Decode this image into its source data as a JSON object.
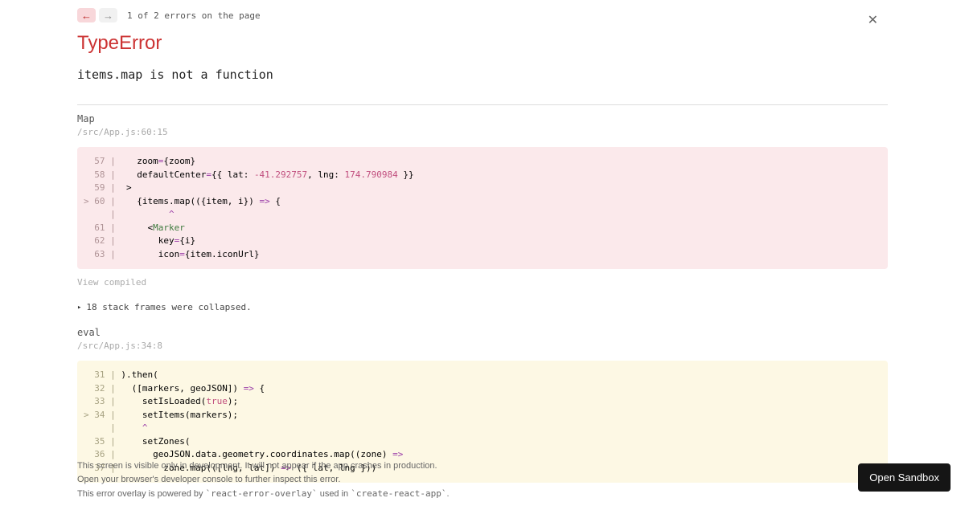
{
  "nav": {
    "counter_text": "1 of 2 errors on the page"
  },
  "error": {
    "type": "TypeError",
    "message": "items.map is not a function"
  },
  "frame1": {
    "name": "Map",
    "location": "/src/App.js:60:15",
    "view_compiled": "View compiled"
  },
  "collapsed_text": "18 stack frames were collapsed.",
  "frame2": {
    "name": "eval",
    "location": "/src/App.js:34:8"
  },
  "footer": {
    "line1": "This screen is visible only in development. It will not appear if the app crashes in production.",
    "line2": "Open your browser's developer console to further inspect this error.",
    "line3_a": "This error overlay is powered by ",
    "line3_b": "`react-error-overlay`",
    "line3_c": " used in ",
    "line3_d": "`create-react-app`",
    "line3_e": "."
  },
  "sandbox_button": "Open Sandbox",
  "code1": {
    "l57_num": "  57 | ",
    "l58_num": "  58 | ",
    "l59_num": "  59 | ",
    "l60_num": "> 60 | ",
    "lptr_num": "     | ",
    "l61_num": "  61 | ",
    "l62_num": "  62 | ",
    "l63_num": "  63 | "
  },
  "code2": {
    "l31_num": "  31 | ",
    "l32_num": "  32 | ",
    "l33_num": "  33 | ",
    "l34_num": "> 34 | ",
    "lptr_num": "     | ",
    "l35_num": "  35 | ",
    "l36_num": "  36 | ",
    "l37_num": "  37 | "
  }
}
